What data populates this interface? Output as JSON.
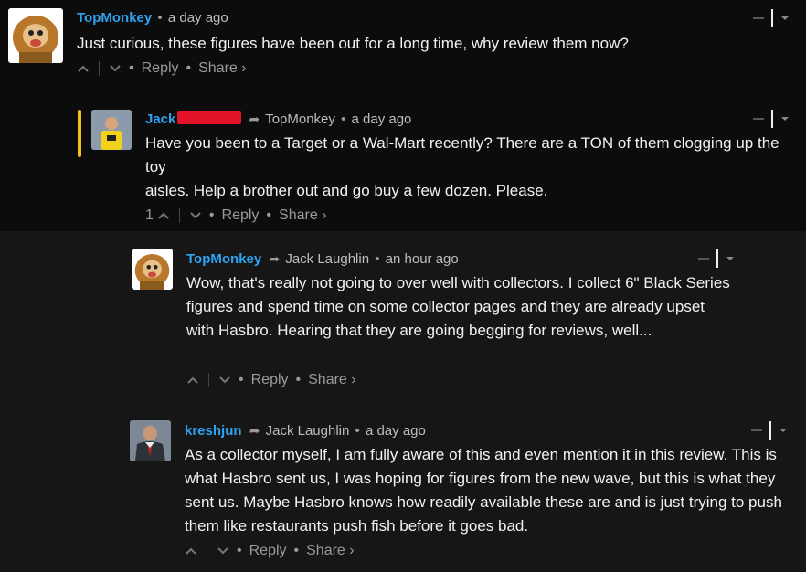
{
  "colors": {
    "background": "#111111",
    "author": "#2ea3f2",
    "redaction": "#e3132a",
    "highlight_bar": "#f2c21b"
  },
  "comments": [
    {
      "author": "TopMonkey",
      "time": "a day ago",
      "reply_to": "",
      "avatar": "monkey-avatar",
      "body": [
        "Just curious, these figures have been out for a long time, why review them now?"
      ],
      "votes": "",
      "reply_label": "Reply",
      "share_label": "Share ›"
    },
    {
      "author": "Jack",
      "time": "a day ago",
      "reply_to": "TopMonkey",
      "avatar": "person-yellow-shirt-avatar",
      "body": [
        "Have you been to a Target or a Wal-Mart recently? There are a TON of them clogging up the toy",
        "aisles. Help a brother out and go buy a few dozen. Please."
      ],
      "votes": "1",
      "reply_label": "Reply",
      "share_label": "Share ›"
    },
    {
      "author": "TopMonkey",
      "time": "an hour ago",
      "reply_to": "Jack Laughlin",
      "avatar": "monkey-avatar",
      "body": [
        "Wow, that's really not going to over well with collectors. I collect 6\" Black Series figures and spend time on some collector pages and they are already upset with Hasbro. Hearing that they are going begging for reviews, well..."
      ],
      "votes": "",
      "reply_label": "Reply",
      "share_label": "Share ›"
    },
    {
      "author": "kreshjun",
      "time": "a day ago",
      "reply_to": "Jack Laughlin",
      "avatar": "man-suit-avatar",
      "body": [
        "As a collector myself, I am fully aware of this and even mention it in this review. This is what Hasbro sent us, I was hoping for figures from the new wave, but this is what they sent us. Maybe Hasbro knows how readily available these are and is just trying to push them like restaurants push fish before it goes bad."
      ],
      "votes": "",
      "reply_label": "Reply",
      "share_label": "Share ›"
    }
  ],
  "separator": "•"
}
